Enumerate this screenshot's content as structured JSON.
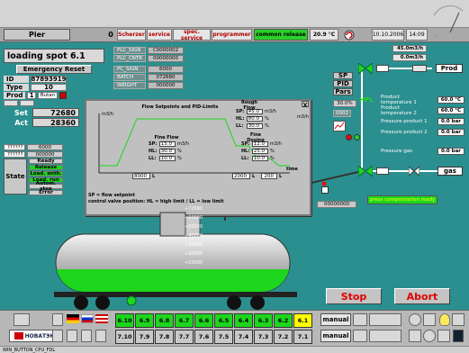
{
  "header": {
    "user": "Pier",
    "counter": "0",
    "buttons": [
      "Scherzer",
      "service",
      "spec. service",
      "programmer"
    ],
    "release": "common release",
    "temperature": "20.9 °C",
    "date": "10.10.2006",
    "time": "14:09"
  },
  "left": {
    "title": "loading spot 6.1",
    "emergency": "Emergency Reset",
    "id_label": "ID",
    "id_value": "87893919",
    "type_label": "Type",
    "type_value": "10",
    "prod_label": "Prod",
    "prod_num": "1",
    "prod_name": "Butan",
    "set_label": "Set",
    "set_value": "72680",
    "act_label": "Act",
    "act_value": "28360",
    "state_label": "State",
    "status_codes": [
      "??????",
      "??????"
    ],
    "status_values": [
      "6000",
      "000000"
    ],
    "states": [
      "Ready",
      "Release",
      "Load. enth.",
      "Load. run",
      "Autom. stop",
      "Error"
    ]
  },
  "plc": {
    "rows": [
      {
        "label": "PLC_SIGN",
        "value": "C0000002"
      },
      {
        "label": "PLC_CNTR",
        "value": "00000000"
      },
      {
        "label": "PC_SIGN",
        "value": "6000"
      },
      {
        "label": "BATCH",
        "value": "072680"
      },
      {
        "label": "WEIGHT",
        "value": "000000"
      }
    ]
  },
  "right": {
    "flow1": "45.0m3/h",
    "flow2": "0.0m3/h",
    "prod_btn": "Prod",
    "sp_btn": "SP",
    "pid_btn": "PID",
    "pars_btn": "Pars",
    "percent": "30.0%",
    "pid_id": "0002",
    "hpl": "HPL",
    "measurements": [
      {
        "label": "Product temperature 1",
        "value": "60.0 °C"
      },
      {
        "label": "Product temperature 2",
        "value": "60.0 °C"
      },
      {
        "label": "Pressure product 1",
        "value": "0.0 bar"
      },
      {
        "label": "Pressure product 2",
        "value": "0.0 bar"
      },
      {
        "label": "Pressure gas",
        "value": "0.0 bar"
      }
    ],
    "gas_btn": "gas",
    "pressure_comp": "press compensation ready",
    "weight_field": "00000000"
  },
  "dialog": {
    "title": "Flow Setpoints and PID-Limits",
    "unit_m3h": "m3/h",
    "rough_flow": {
      "title": "Rough Flow",
      "sp": "45.0",
      "hl": "80.0",
      "ll": "30.0",
      "u1": "m3/h",
      "u2": "%",
      "u3": "%"
    },
    "fine_flow": {
      "title": "Fine Flow",
      "sp": "15.0",
      "hl": "30.0",
      "ll": "10.0",
      "u1": "m3/h",
      "u2": "%",
      "u3": "%"
    },
    "fine_dosing": {
      "title": "Fine Dosing",
      "sp": "12.0",
      "hl": "25.0",
      "ll": "10.0",
      "u1": "m3/h",
      "u2": "%",
      "u3": "%"
    },
    "labels": {
      "sp": "SP:",
      "hl": "HL:",
      "ll": "LL:"
    },
    "vol1": "8000",
    "vol2": "2000",
    "vol3": "200",
    "vol_unit": "L",
    "time_label": "time",
    "legend1": "SP = flow setpoint",
    "legend2": "control valve position: HL = high limit / LL = low limit"
  },
  "tank": {
    "scale": [
      "+72680",
      "+60000",
      "+50000",
      "+40000",
      "+30000",
      "+20000",
      "+10000"
    ],
    "fill_fraction": 0.39
  },
  "actions": {
    "stop": "Stop",
    "abort": "Abort"
  },
  "bottom": {
    "row1": [
      "6.10",
      "6.9",
      "6.8",
      "6.7",
      "6.6",
      "6.5",
      "6.4",
      "6.3",
      "6.2",
      "6.1"
    ],
    "row2": [
      "7.10",
      "7.9",
      "7.8",
      "7.7",
      "7.6",
      "7.5",
      "7.4",
      "7.3",
      "7.2",
      "7.1"
    ],
    "row1_selected": "6.1",
    "manual": "manual",
    "brand": "НОВАТЭК",
    "statusbar": "WIN_BUTTON_CPU_FDL"
  },
  "colors": {
    "bg": "#2b8f8f",
    "green": "#1dd61d",
    "yellow": "#ffff00",
    "red": "#ff0000"
  }
}
